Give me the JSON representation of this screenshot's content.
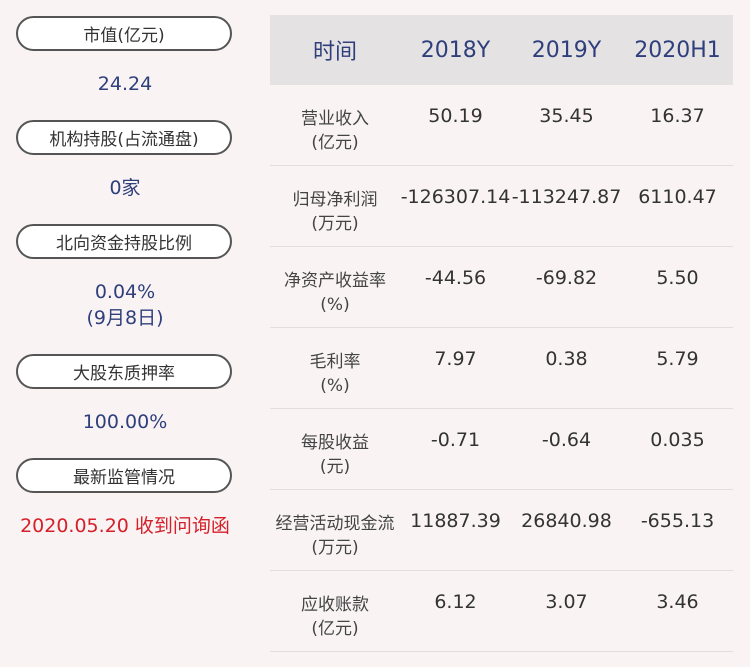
{
  "left_panel": {
    "items": [
      {
        "label": "市值(亿元)",
        "value": "24.24"
      },
      {
        "label": "机构持股(占流通盘)",
        "value": "0家"
      },
      {
        "label": "北向资金持股比例",
        "value": "0.04%",
        "value2": "(9月8日)"
      },
      {
        "label": "大股东质押率",
        "value": "100.00%"
      },
      {
        "label": "最新监管情况",
        "value": "2020.05.20 收到问询函"
      }
    ]
  },
  "table": {
    "headers": [
      "时间",
      "2018Y",
      "2019Y",
      "2020H1"
    ],
    "rows": [
      {
        "label": "营业收入",
        "unit": "(亿元)",
        "values": [
          "50.19",
          "35.45",
          "16.37"
        ]
      },
      {
        "label": "归母净利润",
        "unit": "(万元)",
        "values": [
          "-126307.14",
          "-113247.87",
          "6110.47"
        ]
      },
      {
        "label": "净资产收益率",
        "unit": "(%)",
        "values": [
          "-44.56",
          "-69.82",
          "5.50"
        ]
      },
      {
        "label": "毛利率",
        "unit": "(%)",
        "values": [
          "7.97",
          "0.38",
          "5.79"
        ]
      },
      {
        "label": "每股收益",
        "unit": "(元)",
        "values": [
          "-0.71",
          "-0.64",
          "0.035"
        ]
      },
      {
        "label": "经营活动现金流",
        "unit": "(万元)",
        "values": [
          "11887.39",
          "26840.98",
          "-655.13"
        ]
      },
      {
        "label": "应收账款",
        "unit": "(亿元)",
        "values": [
          "6.12",
          "3.07",
          "3.46"
        ]
      }
    ]
  },
  "colors": {
    "accent": "#2e3f7c",
    "alert": "#d5202a",
    "background": "#f9f3f4"
  }
}
